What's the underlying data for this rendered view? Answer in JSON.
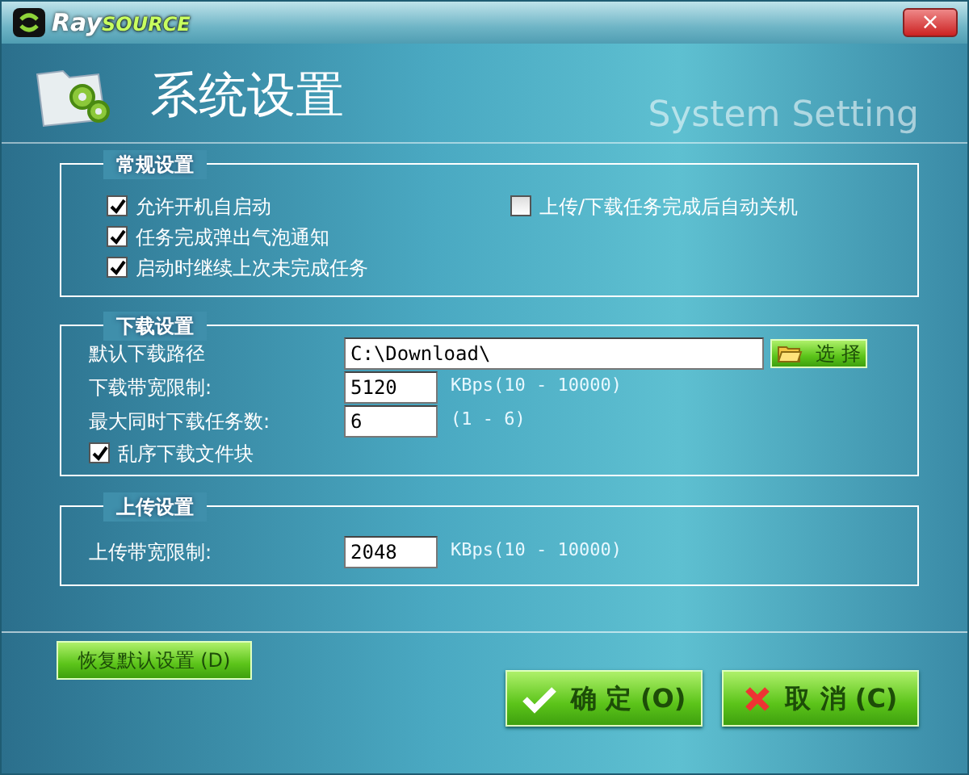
{
  "window": {
    "logo": {
      "main": "Ray",
      "suffix": "SOURCE"
    },
    "close": "×"
  },
  "header": {
    "title": "系统设置",
    "subtitle": "System Setting"
  },
  "general": {
    "title": "常规设置",
    "options": [
      {
        "label": "允许开机自启动",
        "checked": true
      },
      {
        "label": "任务完成弹出气泡通知",
        "checked": true
      },
      {
        "label": "启动时继续上次未完成任务",
        "checked": true
      }
    ],
    "side_options": [
      {
        "label": "上传/下载任务完成后自动关机",
        "checked": false
      }
    ]
  },
  "download": {
    "title": "下载设置",
    "path": {
      "label": "默认下载路径",
      "value": "C:\\Download\\",
      "button": "选 择"
    },
    "fields": [
      {
        "label": "下载带宽限制:",
        "value": "5120",
        "hint": "KBps(10 - 10000)"
      },
      {
        "label": "最大同时下载任务数:",
        "value": "6",
        "hint": "(1 - 6)"
      }
    ],
    "options": [
      {
        "label": "乱序下载文件块",
        "checked": true
      }
    ]
  },
  "upload": {
    "title": "上传设置",
    "fields": [
      {
        "label": "上传带宽限制:",
        "value": "2048",
        "hint": "KBps(10 - 10000)"
      }
    ]
  },
  "buttons": {
    "restore": "恢复默认设置 (D)",
    "ok": "确 定 (O)",
    "cancel": "取 消 (C)"
  }
}
